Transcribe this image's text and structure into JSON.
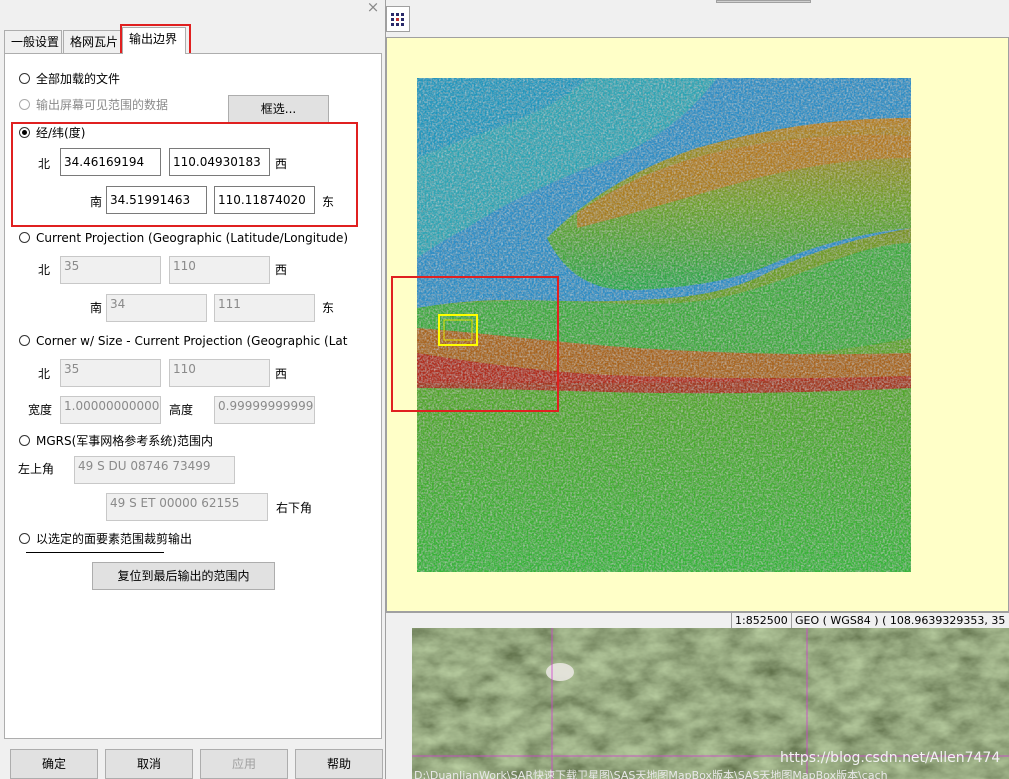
{
  "dialog": {
    "close_glyph": "×",
    "tabs": [
      {
        "label": "一般设置"
      },
      {
        "label": "格网瓦片"
      },
      {
        "label": "输出边界"
      }
    ],
    "options": {
      "all_loaded": "全部加载的文件",
      "visible_extent": "输出屏幕可见范围的数据",
      "select_button": "框选...",
      "latlon": "经/纬(度)",
      "current_projection": "Current Projection (Geographic (Latitude/Longitude) -",
      "corner_size": "Corner w/ Size - Current Projection (Geographic (Latitu",
      "mgrs": "MGRS(军事网格参考系统)范围内",
      "selected_area": "以选定的面要素范围裁剪输出",
      "reset_button": "复位到最后输出的范围内"
    },
    "latlon": {
      "north_label": "北",
      "north": "34.46169194",
      "west": "110.04930183",
      "west_label": "西",
      "south_label": "南",
      "south": "34.51991463",
      "east": "110.11874020",
      "east_label": "东"
    },
    "projection": {
      "north_label": "北",
      "north": "35",
      "west": "110",
      "west_label": "西",
      "south_label": "南",
      "south": "34",
      "east": "111",
      "east_label": "东"
    },
    "corner": {
      "north_label": "北",
      "north": "35",
      "west": "110",
      "west_label": "西",
      "width_label": "宽度",
      "width": "1.000000000000",
      "height_label": "高度",
      "height": "0.999999999999"
    },
    "mgrs": {
      "top_left_label": "左上角",
      "top_left": "49 S DU 08746 73499",
      "bottom_right": "49 S ET 00000 62155",
      "bottom_right_label": "右下角"
    },
    "footer": {
      "ok": "确定",
      "cancel": "取消",
      "apply": "应用",
      "help": "帮助"
    }
  },
  "statusbar": {
    "scale": "1:852500",
    "coords": "GEO ( WGS84 ) ( 108.9639329353, 35"
  },
  "watermark": "https://blog.csdn.net/Allen7474",
  "bottom_path": "D:\\DuanJianWork\\SAR快速下载卫星图\\SAS天地图MapBox版本\\SAS天地图MapBox版本\\cach",
  "colors": {
    "highlight_red": "#e02020",
    "map_background": "#ffffc8",
    "selection_yellow": "#ffff00"
  }
}
